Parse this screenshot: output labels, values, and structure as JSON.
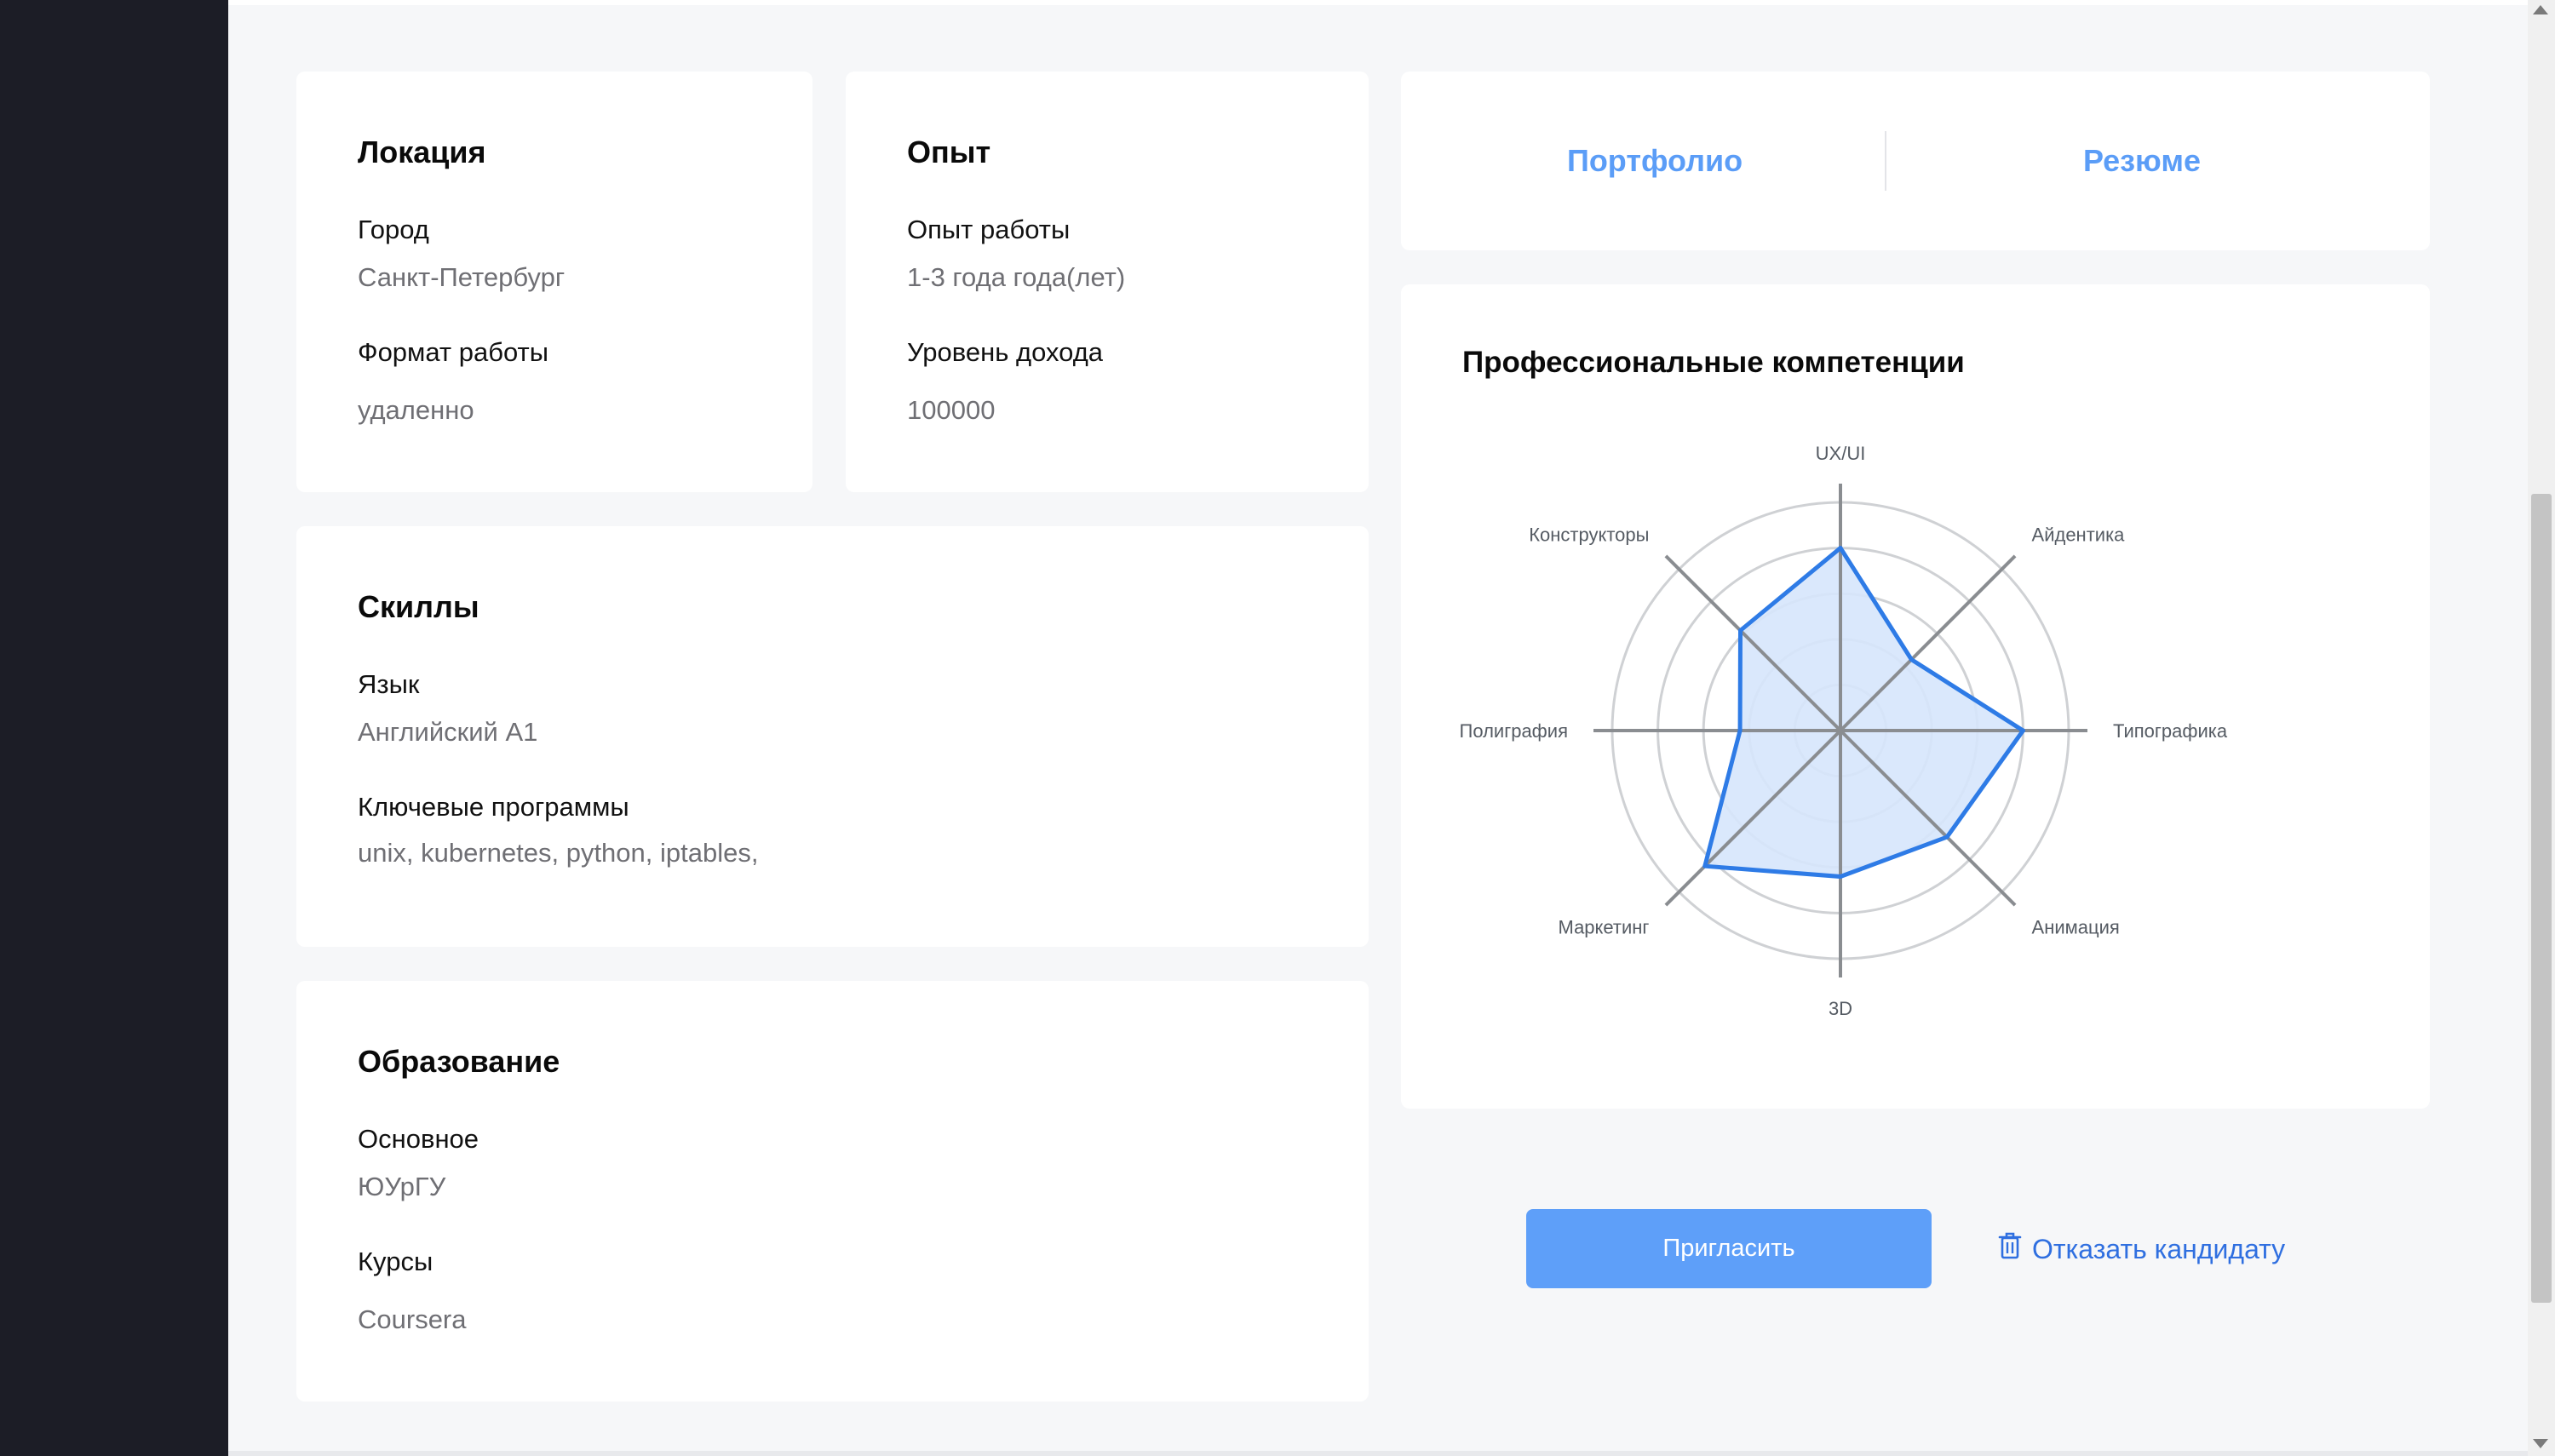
{
  "location": {
    "title": "Локация",
    "city_label": "Город",
    "city_value": "Санкт-Петербург",
    "format_label": "Формат работы",
    "format_value": "удаленно"
  },
  "experience": {
    "title": "Опыт",
    "work_label": "Опыт работы",
    "work_value": "1-3 года года(лет)",
    "income_label": "Уровень дохода",
    "income_value": "100000"
  },
  "skills": {
    "title": "Скиллы",
    "language_label": "Язык",
    "language_value": "Английский А1",
    "programs_label": "Ключевые программы",
    "programs_value": "unix, kubernetes, python, iptables,"
  },
  "education": {
    "title": "Образование",
    "main_label": "Основное",
    "main_value": "ЮУрГУ",
    "courses_label": "Курсы",
    "courses_value": "Coursera"
  },
  "links": {
    "portfolio": "Портфолио",
    "resume": "Резюме"
  },
  "competencies": {
    "title": "Профессиональные компетенции"
  },
  "chart_data": {
    "type": "radar",
    "categories": [
      "UX/UI",
      "Айдентика",
      "Типографика",
      "Анимация",
      "3D",
      "Маркетинг",
      "Полиграфия",
      "Конструкторы"
    ],
    "values": [
      4,
      2.2,
      4,
      3.3,
      3.2,
      4.2,
      2.2,
      3.1
    ],
    "range": [
      0,
      5
    ],
    "rings": 5,
    "colors": {
      "stroke": "#2e7be6",
      "fill": "#d6e5fc",
      "grid": "#cfd1d4",
      "axis": "#8a8d91"
    }
  },
  "actions": {
    "invite": "Пригласить",
    "reject": "Отказать кандидату"
  },
  "icons": {
    "reject": "trash-icon"
  }
}
